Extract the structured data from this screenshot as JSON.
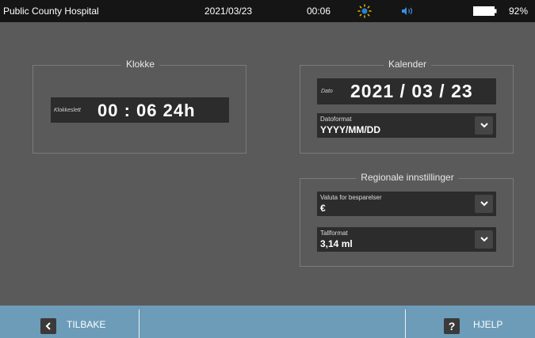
{
  "statusbar": {
    "hospital": "Public County Hospital",
    "date": "2021/03/23",
    "time": "00:06",
    "battery_percent": "92%",
    "icons": [
      "sun-icon",
      "speaker-icon",
      "battery-icon"
    ]
  },
  "clock_panel": {
    "title": "Klokke",
    "field_label": "Klokkeslett",
    "value": "00 : 06  24h"
  },
  "calendar_panel": {
    "title": "Kalender",
    "date_label": "Dato",
    "date_value": "2021 / 03 / 23",
    "format_label": "Datoformat",
    "format_value": "YYYY/MM/DD"
  },
  "regional_panel": {
    "title": "Regionale innstillinger",
    "currency_label": "Valuta for besparelser",
    "currency_value": "€",
    "number_label": "Tallformat",
    "number_value": "3,14 ml"
  },
  "bottombar": {
    "back_label": "TILBAKE",
    "help_label": "HJELP",
    "help_glyph": "?",
    "color": "#6c9cb8"
  }
}
